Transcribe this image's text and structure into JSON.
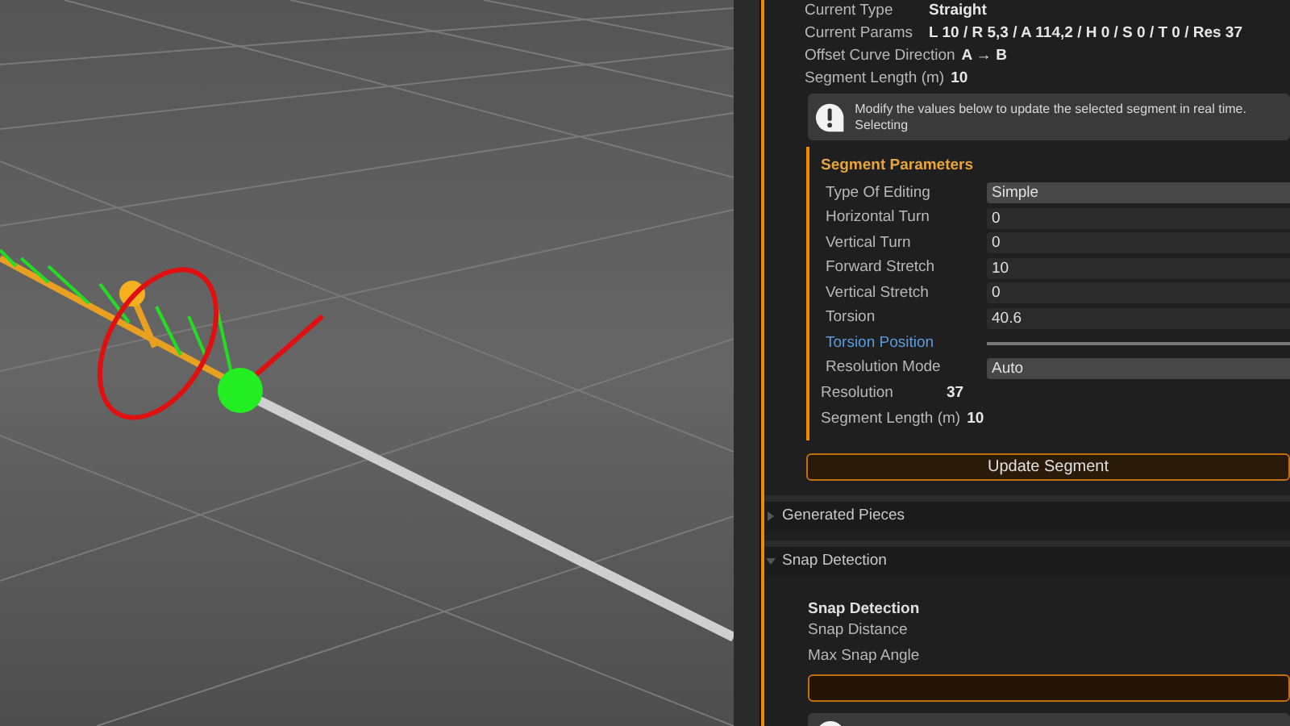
{
  "properties": [
    {
      "label": "Current Type",
      "value": "Straight"
    },
    {
      "label": "Current Params",
      "value": "L 10 / R 5,3 / A 114,2 / H 0 / S 0 / T 0 / Res 37"
    },
    {
      "label": "Offset Curve Direction",
      "value": "A → B"
    },
    {
      "label": "Segment Length (m)",
      "value": "10"
    }
  ],
  "info": "Modify the values below to update the selected segment in real time. Selecting",
  "segment_parameters": {
    "title": "Segment Parameters",
    "fields": [
      {
        "kind": "dropdown",
        "label": "Type Of Editing",
        "value": "Simple"
      },
      {
        "kind": "number",
        "label": "Horizontal Turn",
        "value": "0"
      },
      {
        "kind": "number",
        "label": "Vertical Turn",
        "value": "0"
      },
      {
        "kind": "number",
        "label": "Forward Stretch",
        "value": "10"
      },
      {
        "kind": "number",
        "label": "Vertical Stretch",
        "value": "0"
      },
      {
        "kind": "number",
        "label": "Torsion",
        "value": "40.6"
      },
      {
        "kind": "slider",
        "label": "Torsion Position"
      },
      {
        "kind": "dropdown",
        "label": "Resolution Mode",
        "value": "Auto"
      }
    ],
    "readouts": [
      {
        "label": "Resolution",
        "value": "37"
      },
      {
        "label": "Segment Length (m)",
        "value": "10"
      }
    ]
  },
  "update_button": "Update Segment",
  "sections": [
    {
      "title": "Generated Pieces",
      "expanded": false
    },
    {
      "title": "Snap Detection",
      "expanded": true,
      "subtitle": "Snap Detection",
      "labels": [
        "Snap Distance",
        "Max Snap Angle"
      ]
    }
  ]
}
